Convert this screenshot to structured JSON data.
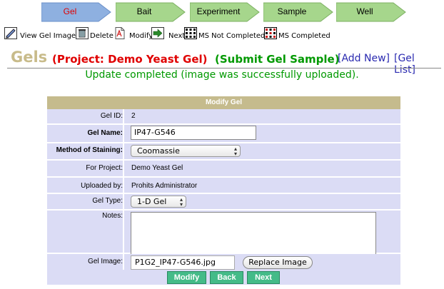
{
  "workflow": {
    "steps": [
      "Gel",
      "Bait",
      "Experiment",
      "Sample",
      "Well"
    ],
    "active_color": "#8eb0e0",
    "inactive_color": "#a6d68c"
  },
  "toolbar": {
    "view_gel_image": "View Gel Image",
    "delete": "Delete",
    "modify": "Modify",
    "next": "Next",
    "ms_not_completed": "MS Not Completed",
    "ms_completed": "MS Completed"
  },
  "header": {
    "title": "Gels",
    "project": "(Project: Demo Yeast Gel)",
    "submit": "(Submit Gel Sample)",
    "add_new": "[Add New]",
    "gel_list": "[Gel List]"
  },
  "status_message": "Update completed (image was successfully uploaded).",
  "form": {
    "heading": "Modify Gel",
    "gel_id_label": "Gel ID:",
    "gel_id_value": "2",
    "gel_name_label": "Gel Name:",
    "gel_name_value": "IP47-G546",
    "method_label": "Method of Staining:",
    "method_value": "Coomassie",
    "project_label": "For Project:",
    "project_value": "Demo Yeast Gel",
    "uploaded_label": "Uploaded by:",
    "uploaded_value": "Prohits Administrator",
    "gel_type_label": "Gel Type:",
    "gel_type_value": "1-D Gel",
    "notes_label": "Notes:",
    "notes_value": "",
    "gel_image_label": "Gel Image:",
    "gel_image_value": "P1G2_IP47-G546.jpg",
    "replace_label": "Replace Image"
  },
  "buttons": {
    "modify": "Modify",
    "back": "Back",
    "next": "Next"
  }
}
